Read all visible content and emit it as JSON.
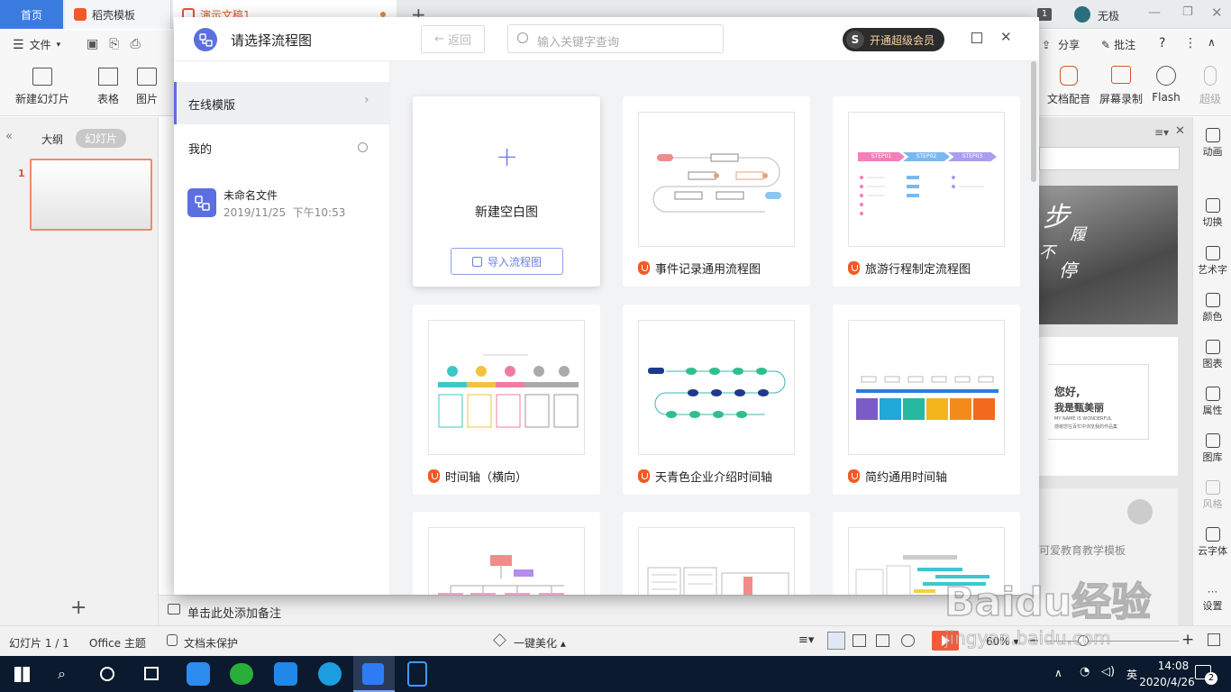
{
  "tabs": {
    "home": "首页",
    "daoke": "稻壳模板",
    "doc": "演示文稿1",
    "account_badge": "1",
    "user": "无极"
  },
  "menu": {
    "file": "文件",
    "share": "分享",
    "comment": "批注"
  },
  "toolbar": {
    "new_slide": "新建幻灯片",
    "table": "表格",
    "picture": "图片",
    "doc_audio": "文档配音",
    "screen_record": "屏幕录制",
    "flash": "Flash",
    "super": "超级"
  },
  "left_panel": {
    "outline_tab": "大纲",
    "slides_tab": "幻灯片",
    "slide_number": "1"
  },
  "notes_placeholder": "单击此处添加备注",
  "right_side": [
    "动画",
    "切换",
    "艺术字",
    "颜色",
    "图表",
    "属性",
    "图库",
    "风格",
    "云字体",
    "设置"
  ],
  "right_panel": {
    "card1_text": [
      "步",
      "履",
      "不",
      "停"
    ],
    "card2_line1": "您好,",
    "card2_line2": "我是甄美丽",
    "card2_sub1": "MY NAME IS WONDERFUL",
    "card2_sub2": "感谢您在百忙中浏览我的作品集",
    "card3_title": "可爱教育教学模板"
  },
  "status": {
    "slide_count": "幻灯片 1 / 1",
    "theme": "Office 主题",
    "protect": "文档未保护",
    "beautify": "一键美化",
    "zoom": "60%"
  },
  "taskbar": {
    "time": "14:08",
    "date": "2020/4/26",
    "notif_count": "2"
  },
  "watermark": {
    "logo": "Baidu经验",
    "url": "jingyan.baidu.com"
  },
  "dialog": {
    "title": "请选择流程图",
    "back": "返回",
    "search_placeholder": "输入关键字查询",
    "vip": "开通超级会员",
    "sidebar": {
      "online": "在线模版",
      "mine": "我的",
      "file_name": "未命名文件",
      "file_time": "2019/11/25  下午10:53"
    },
    "new_blank": "新建空白图",
    "import": "导入流程图",
    "templates": [
      {
        "title": "事件记录通用流程图"
      },
      {
        "title": "旅游行程制定流程图",
        "steps": [
          "STEP01",
          "STEP02",
          "STEP03"
        ]
      },
      {
        "title": "时间轴（横向）"
      },
      {
        "title": "天青色企业介绍时间轴"
      },
      {
        "title": "简约通用时间轴"
      }
    ]
  },
  "colors": {
    "accent": "#3a7be0",
    "brand": "#f05a28",
    "dialog_icon": "#5b6fe0"
  }
}
